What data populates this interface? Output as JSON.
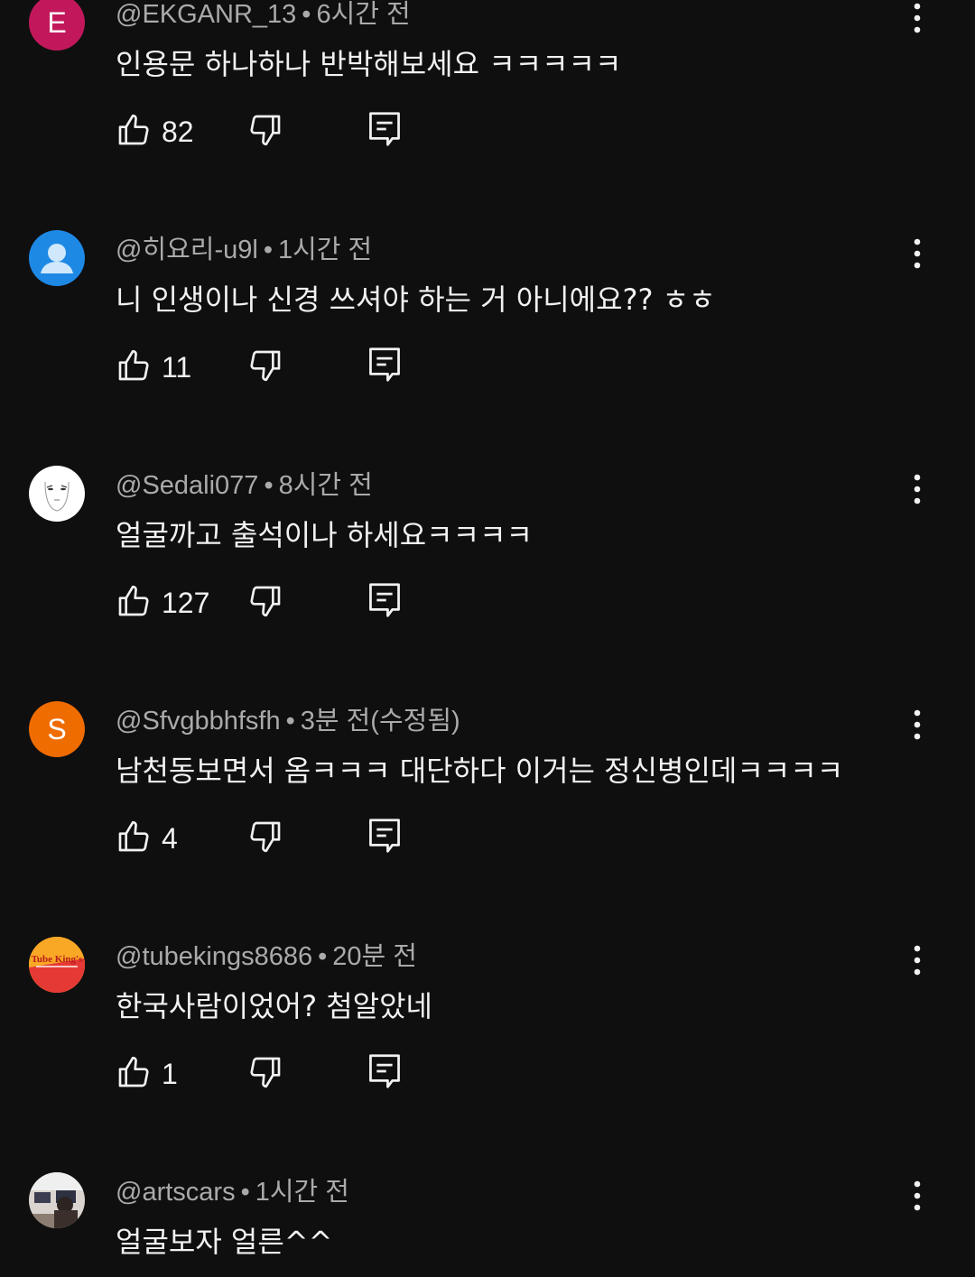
{
  "comments": [
    {
      "author": "@EKGANR_13",
      "time": "6시간 전",
      "text": "인용문 하나하나 반박해보세요 ㅋㅋㅋㅋㅋ",
      "likes": "82",
      "avatar_letter": "E",
      "avatar_color": "#c2185b"
    },
    {
      "author": "@히요리-u9l",
      "time": "1시간 전",
      "text": "니 인생이나 신경 쓰셔야 하는 거 아니에요?? ㅎㅎ",
      "likes": "11",
      "avatar_color": "#1e88e5"
    },
    {
      "author": "@Sedali077",
      "time": "8시간 전",
      "text": "얼굴까고 출석이나 하세요ㅋㅋㅋㅋ",
      "likes": "127",
      "avatar_color": "#ffffff"
    },
    {
      "author": "@Sfvgbbhfsfh",
      "time": "3분 전(수정됨)",
      "text": "남천동보면서 옴ㅋㅋㅋ 대단하다 이거는 정신병인데ㅋㅋㅋㅋ",
      "likes": "4",
      "avatar_letter": "S",
      "avatar_color": "#ef6c00"
    },
    {
      "author": "@tubekings8686",
      "time": "20분 전",
      "text": "한국사람이었어? 첨알았네",
      "likes": "1",
      "avatar_logo_text": "Tube King's",
      "avatar_color": "#f9a825"
    },
    {
      "author": "@artscars",
      "time": "1시간 전",
      "text": "얼굴보자 얼른^^",
      "likes": "",
      "avatar_color": "#6b5a52"
    }
  ],
  "separator": "•",
  "icons": {
    "like": "thumbs-up-icon",
    "dislike": "thumbs-down-icon",
    "reply": "reply-icon",
    "more": "more-vert-icon"
  }
}
